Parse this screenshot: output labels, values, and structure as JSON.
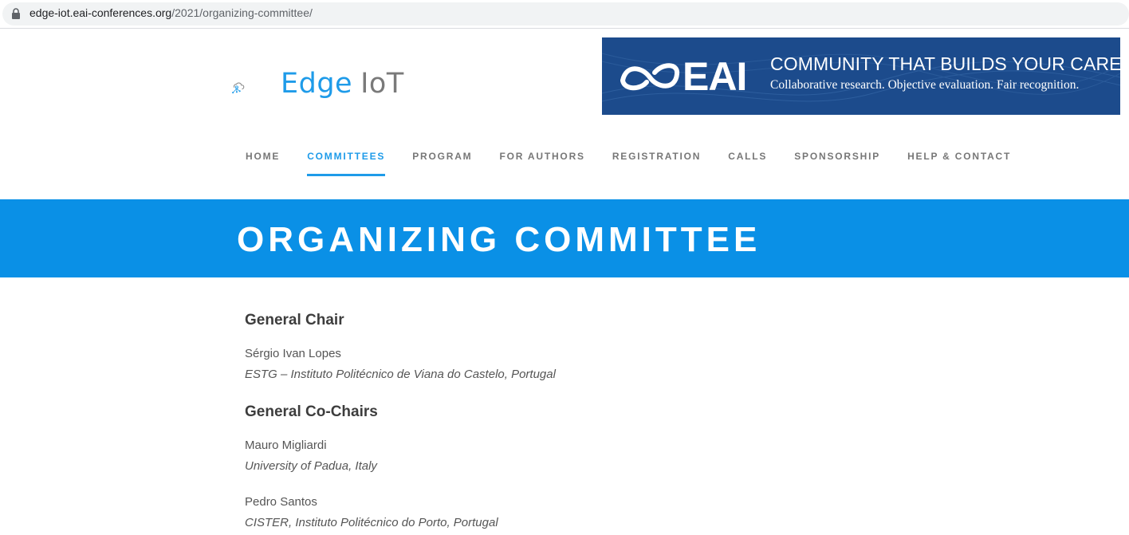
{
  "browser": {
    "url_host": "edge-iot.eai-conferences.org",
    "url_path": "/2021/organizing-committee/"
  },
  "header": {
    "logo_word_1": "Edge",
    "logo_word_2": "IoT",
    "banner": {
      "brand": "EAI",
      "headline": "COMMUNITY THAT BUILDS YOUR CAREER",
      "subline": "Collaborative research.  Objective evaluation.  Fair recognition."
    }
  },
  "nav": {
    "items": [
      {
        "label": "HOME",
        "active": false
      },
      {
        "label": "COMMITTEES",
        "active": true
      },
      {
        "label": "PROGRAM",
        "active": false
      },
      {
        "label": "FOR AUTHORS",
        "active": false
      },
      {
        "label": "REGISTRATION",
        "active": false
      },
      {
        "label": "CALLS",
        "active": false
      },
      {
        "label": "SPONSORSHIP",
        "active": false
      },
      {
        "label": "HELP & CONTACT",
        "active": false
      }
    ]
  },
  "page_title": "ORGANIZING COMMITTEE",
  "sections": [
    {
      "heading": "General Chair",
      "people": [
        {
          "name": "Sérgio Ivan Lopes",
          "affiliation": "ESTG – Instituto Politécnico de Viana do Castelo, Portugal"
        }
      ]
    },
    {
      "heading": "General Co-Chairs",
      "people": [
        {
          "name": "Mauro Migliardi",
          "affiliation": "University of Padua, Italy"
        },
        {
          "name": "Pedro Santos",
          "affiliation": "CISTER, Instituto Politécnico do Porto, Portugal"
        }
      ]
    }
  ],
  "colors": {
    "accent": "#1e9be9",
    "title_bar": "#0a90e6",
    "banner_bg": "#1c4b8c",
    "nav_text": "#777777"
  }
}
